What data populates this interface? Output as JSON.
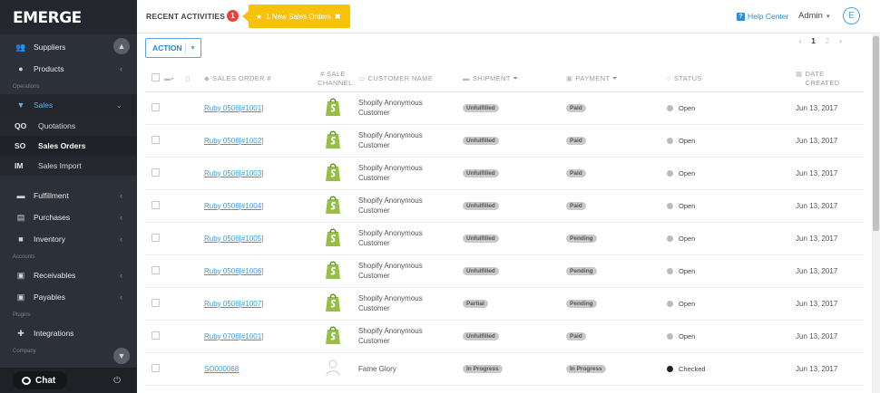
{
  "app": {
    "logo": "EMERGE"
  },
  "sidebar": {
    "top_items": [
      {
        "label": "Suppliers",
        "icon": "users-icon"
      },
      {
        "label": "Products",
        "icon": "tag-icon"
      }
    ],
    "section_operations": "Operations",
    "sales": {
      "label": "Sales",
      "icon": "cart-icon"
    },
    "sales_sub": [
      {
        "badge": "QO",
        "label": "Quotations"
      },
      {
        "badge": "SO",
        "label": "Sales Orders"
      },
      {
        "badge": "IM",
        "label": "Sales Import"
      }
    ],
    "mid_items": [
      {
        "label": "Fulfillment",
        "icon": "truck-icon"
      },
      {
        "label": "Purchases",
        "icon": "basket-icon"
      },
      {
        "label": "Inventory",
        "icon": "cubes-icon"
      }
    ],
    "section_accounts": "Accounts",
    "account_items": [
      {
        "label": "Receivables",
        "icon": "money-icon"
      },
      {
        "label": "Payables",
        "icon": "money-icon"
      }
    ],
    "section_plugins": "Plugins",
    "plugin_items": [
      {
        "label": "Integrations",
        "icon": "plug-icon"
      }
    ],
    "section_company": "Company",
    "chat_label": "Chat"
  },
  "header": {
    "recent_label": "RECENT ACTIVITIES",
    "recent_count": "1",
    "notification": "1 New Sales Orders",
    "help": "Help Center",
    "user": "Admin",
    "avatar_letter": "E"
  },
  "toolbar": {
    "action_label": "ACTION",
    "pager": {
      "prev": "‹",
      "current": "1",
      "next_page": "2",
      "next": "›"
    }
  },
  "table": {
    "headers": {
      "sales_order": "SALES ORDER #",
      "channel": "# SALE CHANNEL",
      "customer": "CUSTOMER NAME",
      "shipment": "SHIPMENT",
      "payment": "PAYMENT",
      "status": "STATUS",
      "date": "DATE CREATED"
    },
    "rows": [
      {
        "order": "Ruby 0506[#1001]",
        "channel": "shopify",
        "customer": "Shopify Anonymous Customer",
        "shipment": "Unfulfilled",
        "payment": "Paid",
        "status": "Open",
        "date": "Jun 13, 2017"
      },
      {
        "order": "Ruby 0506[#1002]",
        "channel": "shopify",
        "customer": "Shopify Anonymous Customer",
        "shipment": "Unfulfilled",
        "payment": "Paid",
        "status": "Open",
        "date": "Jun 13, 2017"
      },
      {
        "order": "Ruby 0506[#1003]",
        "channel": "shopify",
        "customer": "Shopify Anonymous Customer",
        "shipment": "Unfulfilled",
        "payment": "Paid",
        "status": "Open",
        "date": "Jun 13, 2017"
      },
      {
        "order": "Ruby 0506[#1004]",
        "channel": "shopify",
        "customer": "Shopify Anonymous Customer",
        "shipment": "Unfulfilled",
        "payment": "Paid",
        "status": "Open",
        "date": "Jun 13, 2017"
      },
      {
        "order": "Ruby 0506[#1005]",
        "channel": "shopify",
        "customer": "Shopify Anonymous Customer",
        "shipment": "Unfulfilled",
        "payment": "Pending",
        "status": "Open",
        "date": "Jun 13, 2017"
      },
      {
        "order": "Ruby 0506[#1006]",
        "channel": "shopify",
        "customer": "Shopify Anonymous Customer",
        "shipment": "Unfulfilled",
        "payment": "Pending",
        "status": "Open",
        "date": "Jun 13, 2017"
      },
      {
        "order": "Ruby 0506[#1007]",
        "channel": "shopify",
        "customer": "Shopify Anonymous Customer",
        "shipment": "Partial",
        "payment": "Pending",
        "status": "Open",
        "date": "Jun 13, 2017"
      },
      {
        "order": "Ruby 0706[#1001]",
        "channel": "shopify",
        "customer": "Shopify Anonymous Customer",
        "shipment": "Unfulfilled",
        "payment": "Paid",
        "status": "Open",
        "date": "Jun 13, 2017"
      },
      {
        "order": "SO000068",
        "channel": "manual",
        "customer": "Fame Glory",
        "shipment": "In Progress",
        "payment": "In Progress",
        "status": "Checked",
        "date": "Jun 13, 2017"
      }
    ]
  },
  "colors": {
    "accent": "#2b8fd3",
    "notification": "#f6c20c",
    "badge": "#e8433b",
    "shopify": "#95bf47",
    "sidebar": "#2c3038"
  }
}
